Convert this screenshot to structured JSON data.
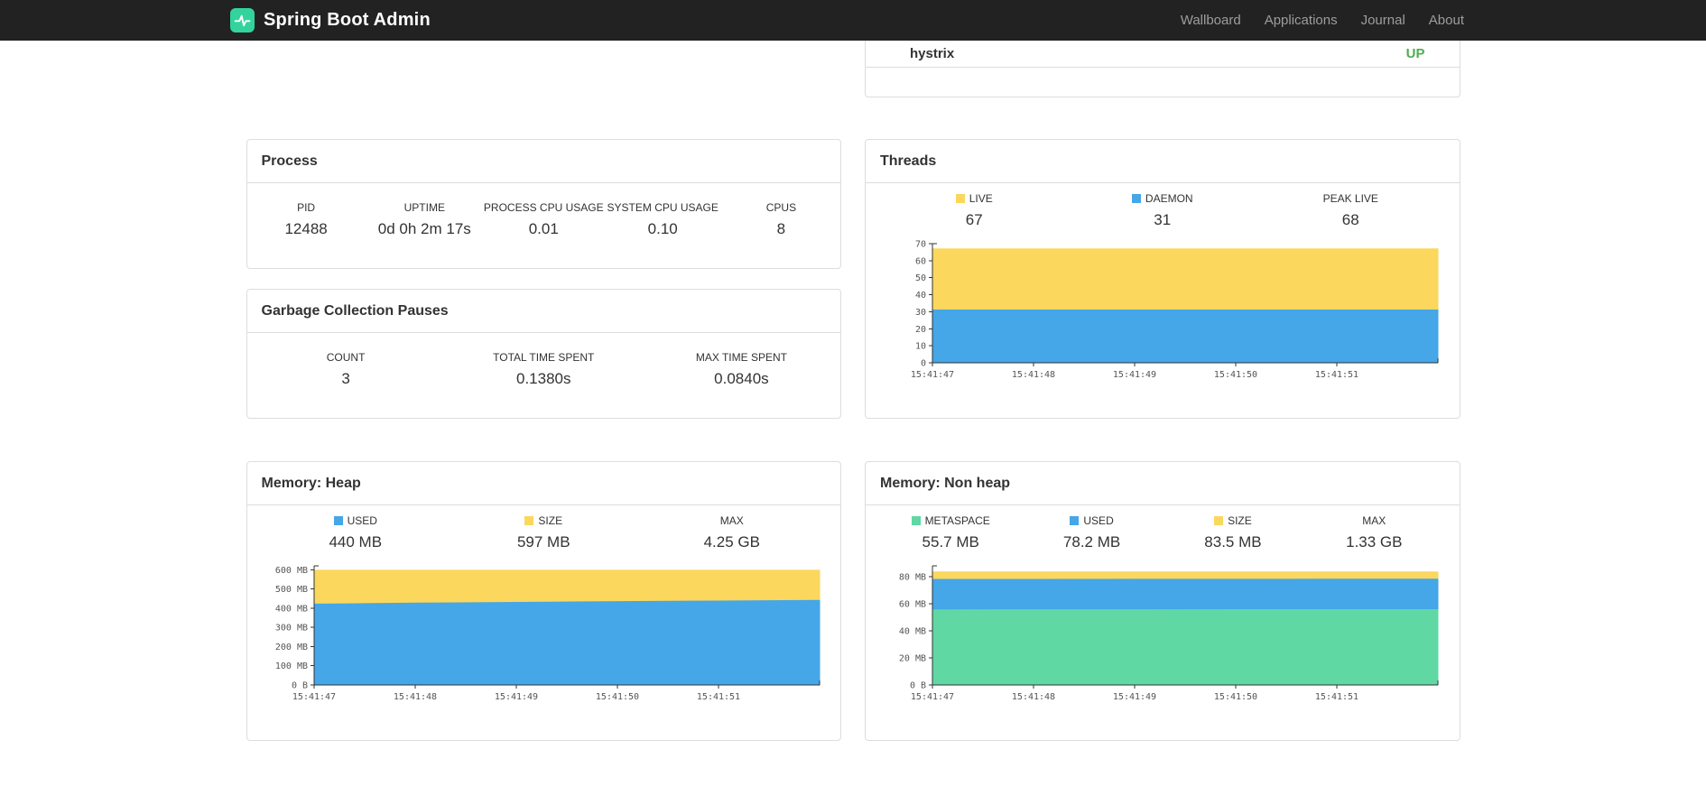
{
  "navbar": {
    "brand": "Spring Boot Admin",
    "links": [
      {
        "label": "Wallboard"
      },
      {
        "label": "Applications"
      },
      {
        "label": "Journal"
      },
      {
        "label": "About"
      }
    ]
  },
  "applications": {
    "row": {
      "name": "hystrix",
      "status": "UP"
    }
  },
  "panels": {
    "process": {
      "title": "Process",
      "stats": [
        {
          "label": "PID",
          "value": "12488"
        },
        {
          "label": "UPTIME",
          "value": "0d 0h 2m 17s"
        },
        {
          "label": "PROCESS CPU USAGE",
          "value": "0.01"
        },
        {
          "label": "SYSTEM CPU USAGE",
          "value": "0.10"
        },
        {
          "label": "CPUS",
          "value": "8"
        }
      ]
    },
    "gc": {
      "title": "Garbage Collection Pauses",
      "stats": [
        {
          "label": "COUNT",
          "value": "3"
        },
        {
          "label": "TOTAL TIME SPENT",
          "value": "0.1380s"
        },
        {
          "label": "MAX TIME SPENT",
          "value": "0.0840s"
        }
      ]
    },
    "threads": {
      "title": "Threads",
      "stats": [
        {
          "label": "LIVE",
          "value": "67",
          "color": "#fbd75e"
        },
        {
          "label": "DAEMON",
          "value": "31",
          "color": "#45a6e8"
        },
        {
          "label": "PEAK LIVE",
          "value": "68"
        }
      ]
    },
    "heap": {
      "title": "Memory: Heap",
      "stats": [
        {
          "label": "USED",
          "value": "440 MB",
          "color": "#45a6e8"
        },
        {
          "label": "SIZE",
          "value": "597 MB",
          "color": "#fbd75e"
        },
        {
          "label": "MAX",
          "value": "4.25 GB"
        }
      ]
    },
    "nonheap": {
      "title": "Memory: Non heap",
      "stats": [
        {
          "label": "METASPACE",
          "value": "55.7 MB",
          "color": "#5fd8a4"
        },
        {
          "label": "USED",
          "value": "78.2 MB",
          "color": "#45a6e8"
        },
        {
          "label": "SIZE",
          "value": "83.5 MB",
          "color": "#fbd75e"
        },
        {
          "label": "MAX",
          "value": "1.33 GB"
        }
      ]
    }
  },
  "colors": {
    "status_up": "#4cae50",
    "navbar_bg": "#222222",
    "logo_teal": "#34d39d",
    "series_blue": "#45a6e8",
    "series_yellow": "#fbd75e",
    "series_green": "#5fd8a4"
  },
  "chart_data": [
    {
      "id": "threads",
      "type": "area",
      "title": "Threads",
      "legend_position": "top",
      "grid": false,
      "x_ticks": [
        "15:41:47",
        "15:41:48",
        "15:41:49",
        "15:41:50",
        "15:41:51"
      ],
      "x_points": 6,
      "ylim": [
        0,
        70
      ],
      "y_ticks": [
        {
          "v": 0,
          "label": "0"
        },
        {
          "v": 10,
          "label": "10"
        },
        {
          "v": 20,
          "label": "20"
        },
        {
          "v": 30,
          "label": "30"
        },
        {
          "v": 40,
          "label": "40"
        },
        {
          "v": 50,
          "label": "50"
        },
        {
          "v": 60,
          "label": "60"
        },
        {
          "v": 70,
          "label": "70"
        }
      ],
      "series": [
        {
          "name": "DAEMON",
          "color": "#45a6e8",
          "values": [
            31,
            31,
            31,
            31,
            31,
            31
          ]
        },
        {
          "name": "LIVE",
          "color": "#fbd75e",
          "values": [
            67,
            67,
            67,
            67,
            67,
            67
          ]
        }
      ]
    },
    {
      "id": "heap",
      "type": "area",
      "title": "Memory: Heap",
      "y_unit": "MB",
      "legend_position": "top",
      "grid": false,
      "x_ticks": [
        "15:41:47",
        "15:41:48",
        "15:41:49",
        "15:41:50",
        "15:41:51"
      ],
      "x_points": 6,
      "ylim": [
        0,
        620
      ],
      "y_ticks": [
        {
          "v": 0,
          "label": "0 B"
        },
        {
          "v": 100,
          "label": "100 MB"
        },
        {
          "v": 200,
          "label": "200 MB"
        },
        {
          "v": 300,
          "label": "300 MB"
        },
        {
          "v": 400,
          "label": "400 MB"
        },
        {
          "v": 500,
          "label": "500 MB"
        },
        {
          "v": 600,
          "label": "600 MB"
        }
      ],
      "series": [
        {
          "name": "USED",
          "color": "#45a6e8",
          "values": [
            421,
            426,
            430,
            434,
            437,
            440
          ]
        },
        {
          "name": "SIZE",
          "color": "#fbd75e",
          "values": [
            597,
            597,
            597,
            597,
            597,
            597
          ]
        }
      ]
    },
    {
      "id": "nonheap",
      "type": "area",
      "title": "Memory: Non heap",
      "y_unit": "MB",
      "legend_position": "top",
      "grid": false,
      "x_ticks": [
        "15:41:47",
        "15:41:48",
        "15:41:49",
        "15:41:50",
        "15:41:51"
      ],
      "x_points": 6,
      "ylim": [
        0,
        88
      ],
      "y_ticks": [
        {
          "v": 0,
          "label": "0 B"
        },
        {
          "v": 20,
          "label": "20 MB"
        },
        {
          "v": 40,
          "label": "40 MB"
        },
        {
          "v": 60,
          "label": "60 MB"
        },
        {
          "v": 80,
          "label": "80 MB"
        }
      ],
      "series": [
        {
          "name": "METASPACE",
          "color": "#5fd8a4",
          "values": [
            55.5,
            55.6,
            55.6,
            55.7,
            55.7,
            55.7
          ]
        },
        {
          "name": "USED",
          "color": "#45a6e8",
          "values": [
            78.0,
            78.0,
            78.1,
            78.1,
            78.2,
            78.2
          ]
        },
        {
          "name": "SIZE",
          "color": "#fbd75e",
          "values": [
            83.5,
            83.5,
            83.5,
            83.5,
            83.5,
            83.5
          ]
        }
      ]
    }
  ]
}
